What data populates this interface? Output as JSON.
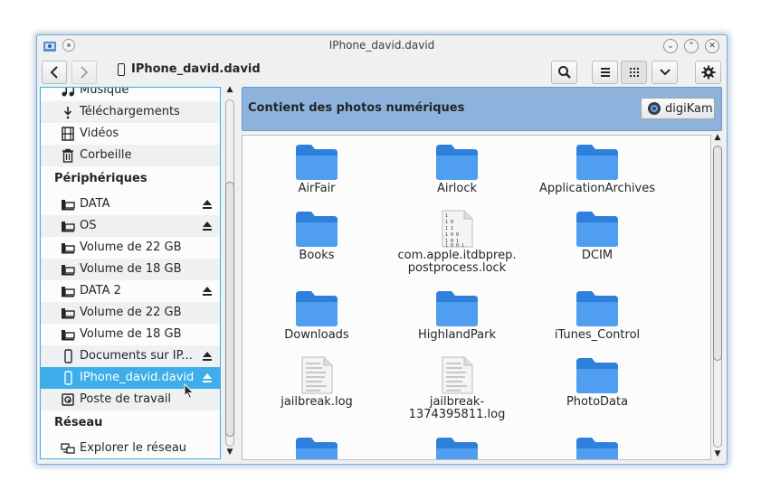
{
  "window": {
    "title": "IPhone_david.david"
  },
  "titlebar": {
    "minimize_icon": "chevron-down-icon",
    "maximize_icon": "chevron-up-icon",
    "close_icon": "close-icon"
  },
  "toolbar": {
    "location": "IPhone_david.david"
  },
  "sidebar": {
    "items": [
      {
        "label": "Musique",
        "icon": "music-icon"
      },
      {
        "label": "Téléchargements",
        "icon": "download-icon"
      },
      {
        "label": "Vidéos",
        "icon": "film-icon"
      },
      {
        "label": "Corbeille",
        "icon": "trash-icon"
      }
    ],
    "section_devices": "Périphériques",
    "devices": [
      {
        "label": "DATA",
        "eject": true
      },
      {
        "label": "OS",
        "eject": true
      },
      {
        "label": "Volume de 22 GB",
        "eject": false
      },
      {
        "label": "Volume de 18 GB",
        "eject": false
      },
      {
        "label": "DATA 2",
        "eject": true
      },
      {
        "label": "Volume de 22 GB",
        "eject": false
      },
      {
        "label": "Volume de 18 GB",
        "eject": false
      },
      {
        "label": "Documents sur IP...",
        "eject": true
      },
      {
        "label": "IPhone_david.david",
        "eject": true
      },
      {
        "label": "Poste de travail",
        "eject": false
      }
    ],
    "section_network": "Réseau",
    "network": [
      {
        "label": "Explorer le réseau"
      }
    ]
  },
  "info_bar": {
    "text": "Contient des photos numériques",
    "button_label": "digiKam"
  },
  "files": [
    {
      "name": "AirFair",
      "type": "folder"
    },
    {
      "name": "Airlock",
      "type": "folder"
    },
    {
      "name": "ApplicationArchives",
      "type": "folder"
    },
    {
      "name": "Books",
      "type": "folder"
    },
    {
      "name": "com.apple.itdbprep.\npostprocess.lock",
      "type": "binary"
    },
    {
      "name": "DCIM",
      "type": "folder"
    },
    {
      "name": "Downloads",
      "type": "folder"
    },
    {
      "name": "HighlandPark",
      "type": "folder"
    },
    {
      "name": "iTunes_Control",
      "type": "folder"
    },
    {
      "name": "jailbreak.log",
      "type": "text"
    },
    {
      "name": "jailbreak-\n1374395811.log",
      "type": "text"
    },
    {
      "name": "PhotoData",
      "type": "folder"
    },
    {
      "name": "",
      "type": "folder"
    },
    {
      "name": "",
      "type": "folder"
    },
    {
      "name": "",
      "type": "folder"
    }
  ],
  "colors": {
    "accent": "#3daee9",
    "folder": "#3a8ee6",
    "info_bar": "#8db3dc"
  }
}
